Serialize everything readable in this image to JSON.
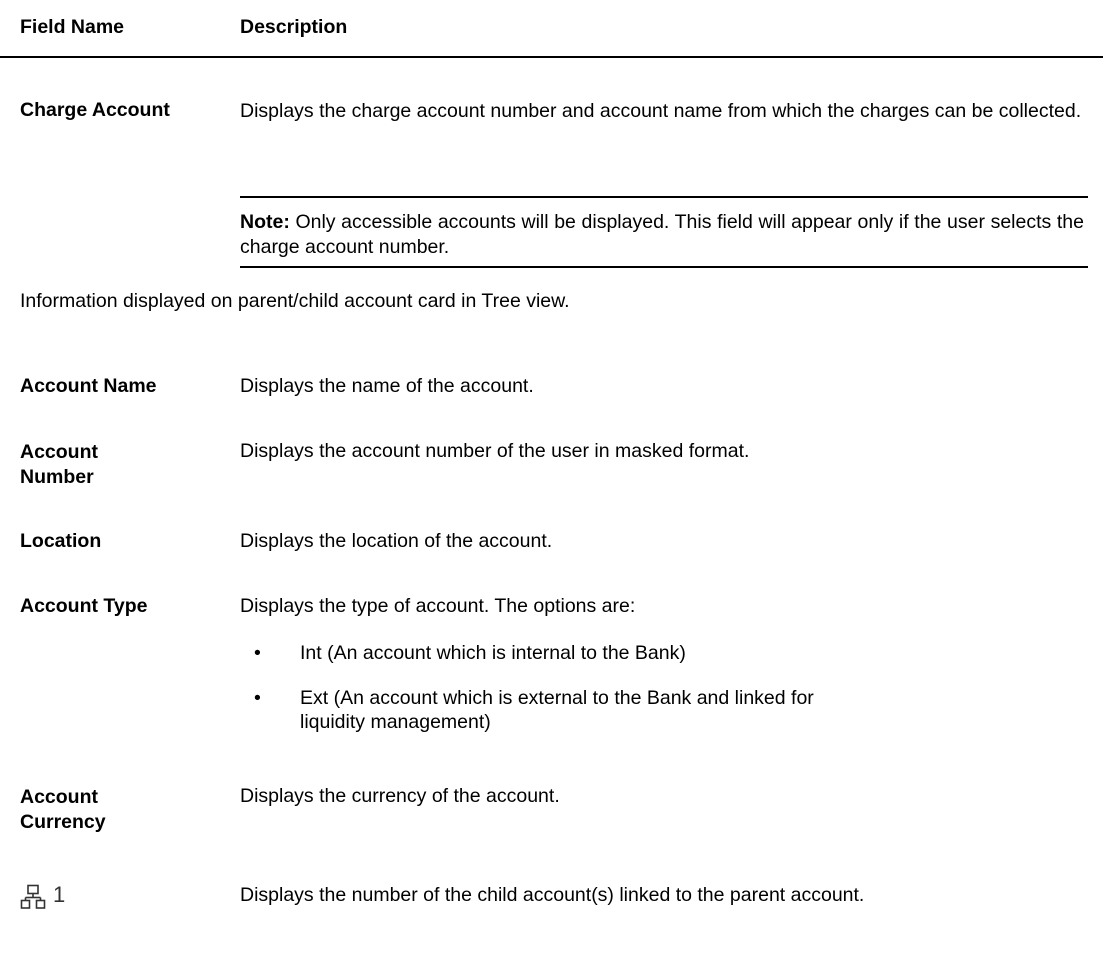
{
  "header": {
    "field_name": "Field Name",
    "description": "Description"
  },
  "charge_account": {
    "label": "Charge Account",
    "description": "Displays the charge account number and account name from which the charges can be collected.",
    "note_label": "Note:",
    "note_text": " Only accessible accounts will be displayed. This field will appear only if the user selects the charge account number."
  },
  "intro": "Information displayed on parent/child account card in Tree view.",
  "fields": [
    {
      "label": "Account Name",
      "description": "Displays the name of the account."
    },
    {
      "label": "Account Number",
      "description": "Displays the account number of the user in masked format."
    },
    {
      "label": "Location",
      "description": "Displays the location of the account."
    },
    {
      "label": "Account Type",
      "description": "Displays the type of account. The options are:"
    },
    {
      "label": "Account Currency",
      "description": "Displays the currency of the account."
    }
  ],
  "account_type_options": [
    "Int (An account which is internal to the Bank)",
    "Ext (An account which is external to the Bank and linked for liquidity management)"
  ],
  "child_accounts": {
    "icon": "hierarchy-icon",
    "count": "1",
    "description": "Displays the number of the child account(s) linked to the parent account."
  }
}
